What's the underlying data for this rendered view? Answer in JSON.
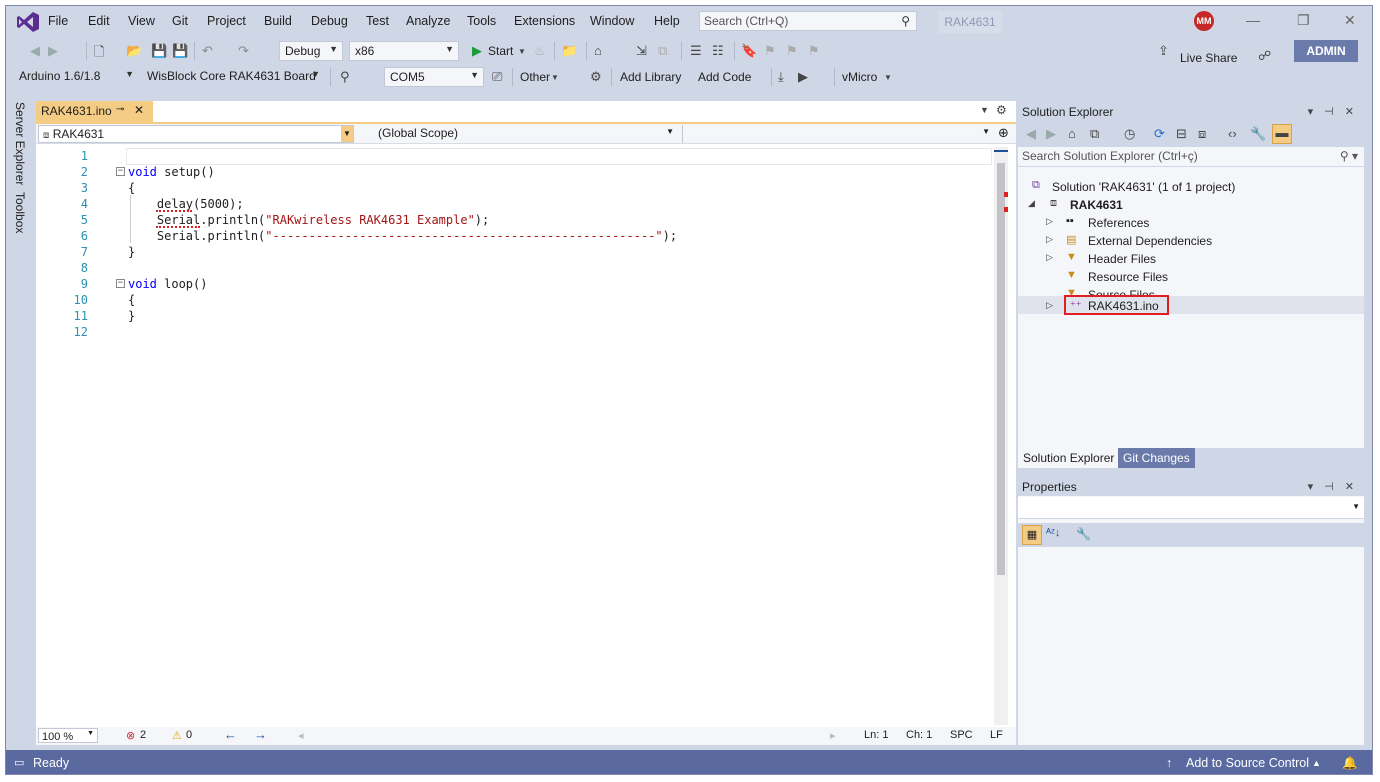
{
  "menu": {
    "items": [
      "File",
      "Edit",
      "View",
      "Git",
      "Project",
      "Build",
      "Debug",
      "Test",
      "Analyze",
      "Tools",
      "Extensions",
      "Window",
      "Help"
    ],
    "search_placeholder": "Search (Ctrl+Q)",
    "solution_badge": "RAK4631",
    "avatar_initials": "MM"
  },
  "toolbar1": {
    "config": "Debug",
    "platform": "x86",
    "start_label": "Start",
    "live_share": "Live Share",
    "admin": "ADMIN"
  },
  "toolbar2": {
    "ide_version": "Arduino 1.6/1.8",
    "board": "WisBlock Core RAK4631 Board",
    "port": "COM5",
    "other": "Other",
    "add_library": "Add Library",
    "add_code": "Add Code",
    "vmicro": "vMicro"
  },
  "left_dock": {
    "server_explorer": "Server Explorer",
    "toolbox": "Toolbox"
  },
  "editor": {
    "tab_label": "RAK4631.ino",
    "project_scope": "RAK4631",
    "scope": "(Global Scope)",
    "lines": [
      {
        "n": "1",
        "segments": []
      },
      {
        "n": "2",
        "segments": [
          {
            "t": "void",
            "c": "kw"
          },
          {
            "t": " setup()",
            "c": ""
          }
        ]
      },
      {
        "n": "3",
        "segments": [
          {
            "t": "{",
            "c": ""
          }
        ]
      },
      {
        "n": "4",
        "segments": [
          {
            "t": "    delay(5000);",
            "c": ""
          }
        ]
      },
      {
        "n": "5",
        "segments": [
          {
            "t": "    Serial.println(",
            "c": ""
          },
          {
            "t": "\"RAKwireless RAK4631 Example\"",
            "c": "str"
          },
          {
            "t": ");",
            "c": ""
          }
        ]
      },
      {
        "n": "6",
        "segments": [
          {
            "t": "    Serial.println(",
            "c": ""
          },
          {
            "t": "\"-----------------------------------------------------\"",
            "c": "str"
          },
          {
            "t": ");",
            "c": ""
          }
        ]
      },
      {
        "n": "7",
        "segments": [
          {
            "t": "}",
            "c": ""
          }
        ]
      },
      {
        "n": "8",
        "segments": []
      },
      {
        "n": "9",
        "segments": [
          {
            "t": "void",
            "c": "kw"
          },
          {
            "t": " loop()",
            "c": ""
          }
        ]
      },
      {
        "n": "10",
        "segments": [
          {
            "t": "{",
            "c": ""
          }
        ]
      },
      {
        "n": "11",
        "segments": [
          {
            "t": "}",
            "c": ""
          }
        ]
      },
      {
        "n": "12",
        "segments": []
      }
    ],
    "zoom": "100 %",
    "errors": "2",
    "warnings": "0",
    "ln": "Ln: 1",
    "ch": "Ch: 1",
    "spc": "SPC",
    "lf": "LF"
  },
  "solution_explorer": {
    "title": "Solution Explorer",
    "search_placeholder": "Search Solution Explorer (Ctrl+ç)",
    "solution": "Solution 'RAK4631' (1 of 1 project)",
    "project": "RAK4631",
    "items": [
      "References",
      "External Dependencies",
      "Header Files",
      "Resource Files",
      "Source Files",
      "RAK4631.ino"
    ],
    "tab_solution": "Solution Explorer",
    "tab_git": "Git Changes"
  },
  "properties": {
    "title": "Properties"
  },
  "statusbar": {
    "ready": "Ready",
    "add_source_control": "Add to Source Control"
  },
  "colors": {
    "accent": "#5a6aa0",
    "tab_active": "#f5cc84",
    "highlight_box": "#e02020"
  }
}
